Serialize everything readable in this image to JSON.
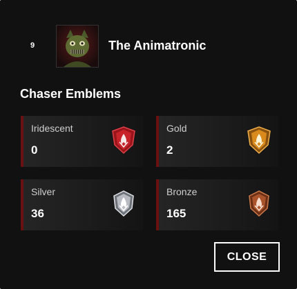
{
  "character": {
    "rank": "9",
    "name": "The Animatronic"
  },
  "section": {
    "title": "Chaser Emblems"
  },
  "emblems": [
    {
      "label": "Iridescent",
      "count": "0",
      "icon": "iridescent-emblem-icon",
      "color": "#c8232a"
    },
    {
      "label": "Gold",
      "count": "2",
      "icon": "gold-emblem-icon",
      "color": "#d98a1c"
    },
    {
      "label": "Silver",
      "count": "36",
      "icon": "silver-emblem-icon",
      "color": "#b8bcc2"
    },
    {
      "label": "Bronze",
      "count": "165",
      "icon": "bronze-emblem-icon",
      "color": "#a9542a"
    }
  ],
  "actions": {
    "close_label": "CLOSE"
  }
}
